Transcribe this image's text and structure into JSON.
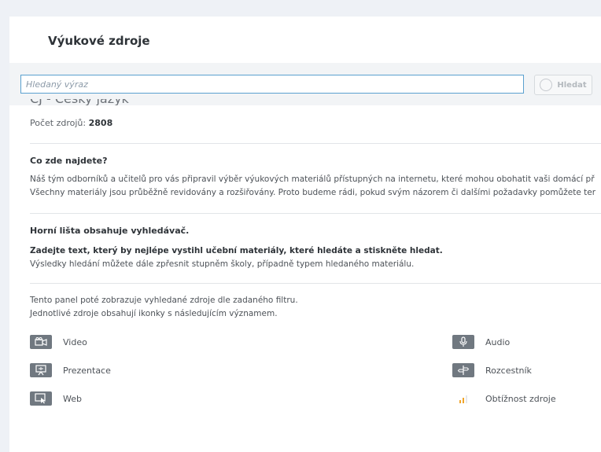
{
  "panel": {
    "title": "Výukové zdroje"
  },
  "search": {
    "placeholder": "Hledaný výraz",
    "button_label": "Hledat"
  },
  "subject": {
    "title": "ČJ - Český jazyk",
    "count_label": "Počet zdrojů:",
    "count_value": "2808"
  },
  "section1": {
    "heading": "Co zde najdete?",
    "line1": "Náš tým odborníků a učitelů pro vás připravil výběr výukových materiálů přístupných na internetu, které mohou obohatit vaši domácí př",
    "line2": "Všechny materiály jsou průběžně revidovány a rozšiřovány. Proto budeme rádi, pokud svým názorem či dalšími požadavky pomůžete ter"
  },
  "section2": {
    "heading": "Horní lišta obsahuje vyhledávač.",
    "line1": "Zadejte text, který by nejlépe vystihl učební materiály, které hledáte a stiskněte hledat.",
    "line2": "Výsledky hledání můžete dále zpřesnit stupněm školy, případně typem hledaného materiálu."
  },
  "section3": {
    "line1": "Tento panel poté zobrazuje vyhledané zdroje dle zadaného filtru.",
    "line2": "Jednotlivé zdroje obsahují ikonky s následujícím významem."
  },
  "legend": {
    "video": {
      "label": "Video",
      "icon": "video-camera-icon"
    },
    "presentation": {
      "label": "Prezentace",
      "icon": "projector-screen-icon"
    },
    "web": {
      "label": "Web",
      "icon": "web-cursor-icon"
    },
    "audio": {
      "label": "Audio",
      "icon": "microphone-icon"
    },
    "signpost": {
      "label": "Rozcestník",
      "icon": "signpost-icon"
    },
    "difficulty": {
      "label": "Obtížnost zdroje",
      "icon": "difficulty-bars-icon"
    }
  },
  "colors": {
    "icon_bg": "#707880",
    "accent_border": "#5aa0cf",
    "difficulty_low": "#f0a52b",
    "difficulty_mid": "#f0a52b",
    "difficulty_high": "#e5e7ea"
  }
}
